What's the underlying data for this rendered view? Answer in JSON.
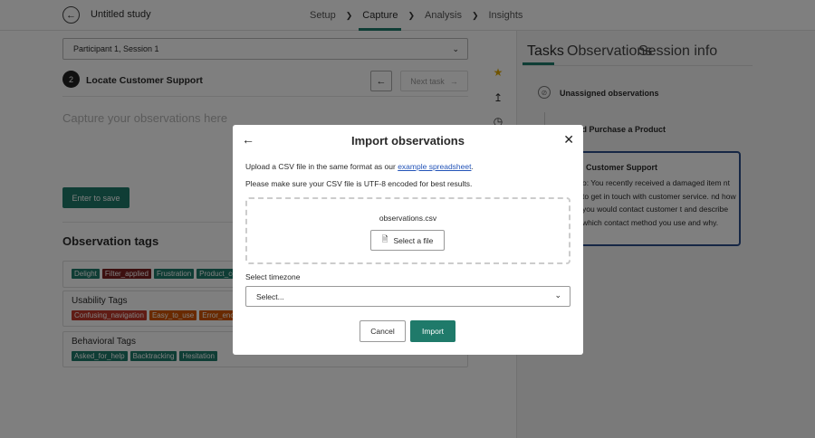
{
  "header": {
    "title": "Untitled study",
    "steps": [
      "Setup",
      "Capture",
      "Analysis",
      "Insights"
    ],
    "active_step": "Capture"
  },
  "main": {
    "participant": "Participant 1, Session 1",
    "task_number": "2",
    "task_title": "Locate Customer Support",
    "next_task_label": "Next task",
    "observation_placeholder": "Capture your observations here",
    "enter_label": "Enter to save",
    "tags_title": "Observation tags",
    "tag_groups": [
      {
        "title": "",
        "tags": [
          "Delight",
          "Filter_applied",
          "Frustration",
          "Product_co"
        ]
      },
      {
        "title": "Usability Tags",
        "tags": [
          "Confusing_navigation",
          "Easy_to_use",
          "Error_encou"
        ]
      },
      {
        "title": "Behavioral Tags",
        "tags": [
          "Asked_for_help",
          "Backtracking",
          "Hesitation"
        ]
      }
    ]
  },
  "right_panel": {
    "tabs": [
      "Tasks",
      "Observations",
      "Session info"
    ],
    "active_tab": "Tasks",
    "unassigned_label": "Unassigned observations",
    "task1_label": "nd Purchase a Product",
    "task2_title": "Customer Support",
    "task2_text": "o: You recently received a damaged item nt to get in touch with customer service. nd how you would contact customer t and describe which contact method you use and why."
  },
  "modal": {
    "title": "Import observations",
    "line1_prefix": "Upload a CSV file in the same format as our ",
    "line1_link": "example spreadsheet",
    "line1_suffix": ".",
    "line2": "Please make sure your CSV file is UTF-8 encoded for best results.",
    "file_name": "observations.csv",
    "select_file_label": "Select a file",
    "timezone_label": "Select timezone",
    "timezone_value": "Select...",
    "cancel_label": "Cancel",
    "import_label": "Import"
  },
  "colors": {
    "accent": "#1f7a6a",
    "card_border": "#2d4f8a",
    "link": "#2354b8",
    "star": "#e0a800"
  }
}
